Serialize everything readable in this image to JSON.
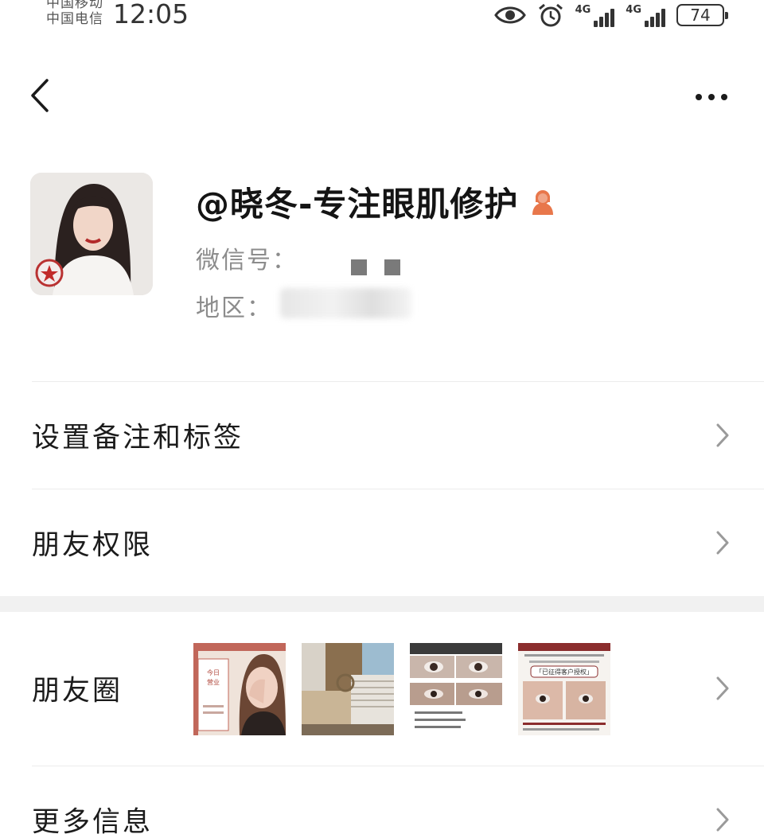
{
  "status_bar": {
    "carrier_1": "中国移动",
    "carrier_2": "中国电信",
    "time": "12:05",
    "network_1": "4G",
    "network_2": "4G",
    "battery": "74"
  },
  "profile": {
    "nickname": "@晓冬-专注眼肌修护",
    "wechat_id_label": "微信号：",
    "region_label": "地区："
  },
  "menu": {
    "remark": "设置备注和标签",
    "permissions": "朋友权限",
    "moments": "朋友圈",
    "more_info": "更多信息"
  },
  "moments_thumbnails": {
    "thumb_1": {
      "heading_line_1": "今日",
      "heading_line_2": "营业"
    },
    "thumb_4": {
      "banner": "「已征得客户授权」"
    }
  },
  "colors": {
    "accent_gender": "#e8774b",
    "text_primary": "#1b1b1b",
    "text_secondary": "#8c8c8c",
    "divider": "#ececec",
    "section_gap": "#f1f1f1"
  }
}
